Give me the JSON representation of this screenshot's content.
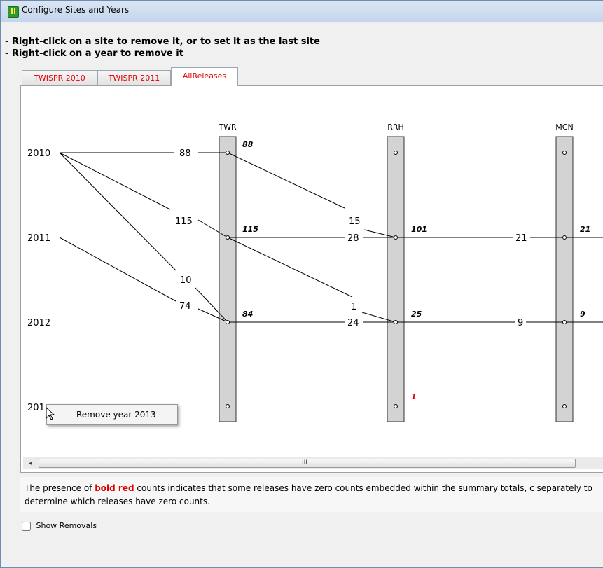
{
  "window": {
    "title": "Configure Sites and Years"
  },
  "instructions": [
    "- Right-click on a site to remove it, or to set it as the last site",
    "- Right-click on a year to remove it"
  ],
  "tabs": [
    {
      "label": "TWISPR 2010",
      "active": false
    },
    {
      "label": "TWISPR 2011",
      "active": false
    },
    {
      "label": "AllReleases",
      "active": true
    }
  ],
  "years": [
    "2010",
    "2011",
    "2012",
    "201"
  ],
  "sites": [
    "TWR",
    "RRH",
    "MCN"
  ],
  "counts": {
    "edge_2010_twr": "88",
    "edge_2010_115": "115",
    "edge_2010_10": "10",
    "edge_2011_74": "74",
    "twr_to_rrh_15": "15",
    "twr_to_rrh_28": "28",
    "twr_to_rrh_1": "1",
    "twr_to_rrh_24": "24",
    "rrh_to_mcn_21": "21",
    "rrh_to_mcn_9": "9"
  },
  "node_totals": {
    "twr_2010": "88",
    "twr_2011": "115",
    "twr_2012": "84",
    "rrh_2011": "101",
    "rrh_2012": "25",
    "rrh_2013": "1",
    "mcn_2011": "21",
    "mcn_2012": "9"
  },
  "context_menu": {
    "item": "Remove year 2013"
  },
  "scrollbar": {
    "grip": "III",
    "left_arrow": "◂"
  },
  "description": {
    "before": "The presence of ",
    "highlight": "bold red",
    "after": " counts indicates that some releases have zero counts embedded within the summary totals, c separately to determine which releases have zero counts."
  },
  "show_removals": {
    "label": "Show Removals",
    "checked": false
  },
  "colors": {
    "accent_red": "#e00000",
    "bar_fill": "#d3d3d3"
  }
}
